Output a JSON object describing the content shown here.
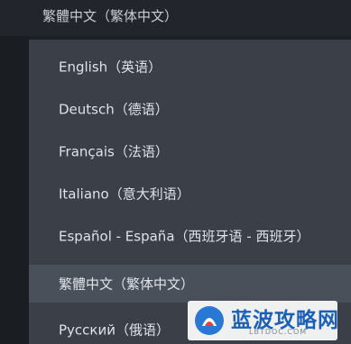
{
  "language_select": {
    "selected_value": "繁體中文（繁体中文）",
    "options": [
      {
        "label": "English（英语）"
      },
      {
        "label": "Deutsch（德语）"
      },
      {
        "label": "Français（法语）"
      },
      {
        "label": "Italiano（意大利语）"
      },
      {
        "label": "Español - España（西班牙语 - 西班牙）"
      },
      {
        "label": "繁體中文（繁体中文）"
      },
      {
        "label": "Русский（俄语）"
      }
    ],
    "highlighted_index": 5
  },
  "watermark": {
    "title": "蓝波攻略网",
    "url": "LBTDOC.COM"
  },
  "colors": {
    "background": "#1d2126",
    "dropdown": "#3a3f48",
    "highlight": "#4a505a",
    "text": "#dfe3e8",
    "watermark_blue": "#1c5fb7"
  }
}
